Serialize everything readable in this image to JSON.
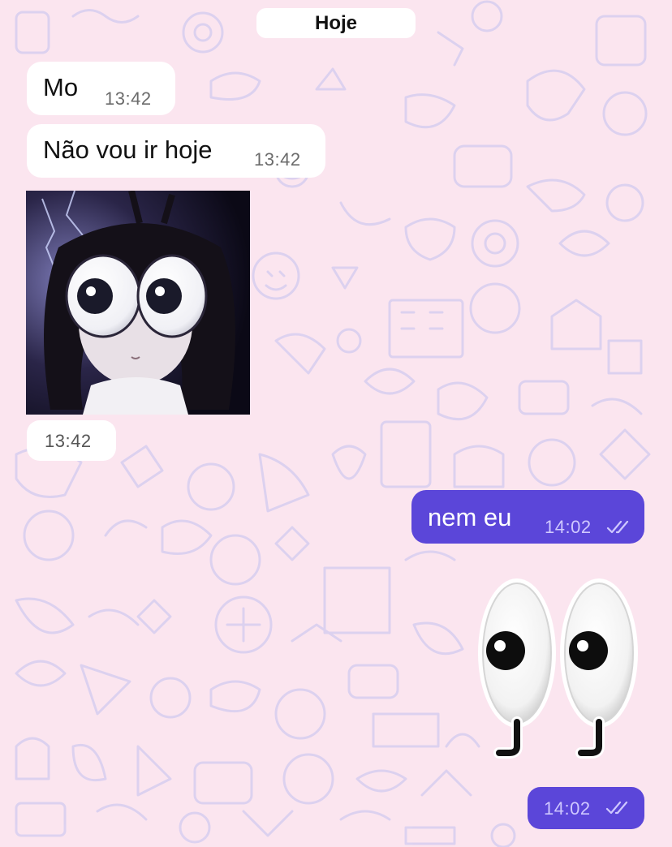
{
  "chat": {
    "date_separator": "Hoje",
    "messages": [
      {
        "direction": "incoming",
        "type": "text",
        "text": "Mo",
        "time": "13:42"
      },
      {
        "direction": "incoming",
        "type": "text",
        "text": "Não vou ir hoje",
        "time": "13:42"
      },
      {
        "direction": "incoming",
        "type": "image",
        "content": "anime girl with big googly eyes",
        "time": "13:42"
      },
      {
        "direction": "outgoing",
        "type": "text",
        "text": "nem eu",
        "time": "14:02",
        "status": "read"
      },
      {
        "direction": "outgoing",
        "type": "sticker",
        "content": "googly-eyes sticker",
        "time": "14:02",
        "status": "read"
      }
    ]
  },
  "colors": {
    "background": "#fbe5ef",
    "wallpaper_doodles": "#d6ccef",
    "incoming_bubble": "#ffffff",
    "outgoing_bubble": "#5b46d9",
    "outgoing_meta": "#cfc8ff"
  },
  "icons": {
    "read_receipt": "double-check-icon"
  }
}
